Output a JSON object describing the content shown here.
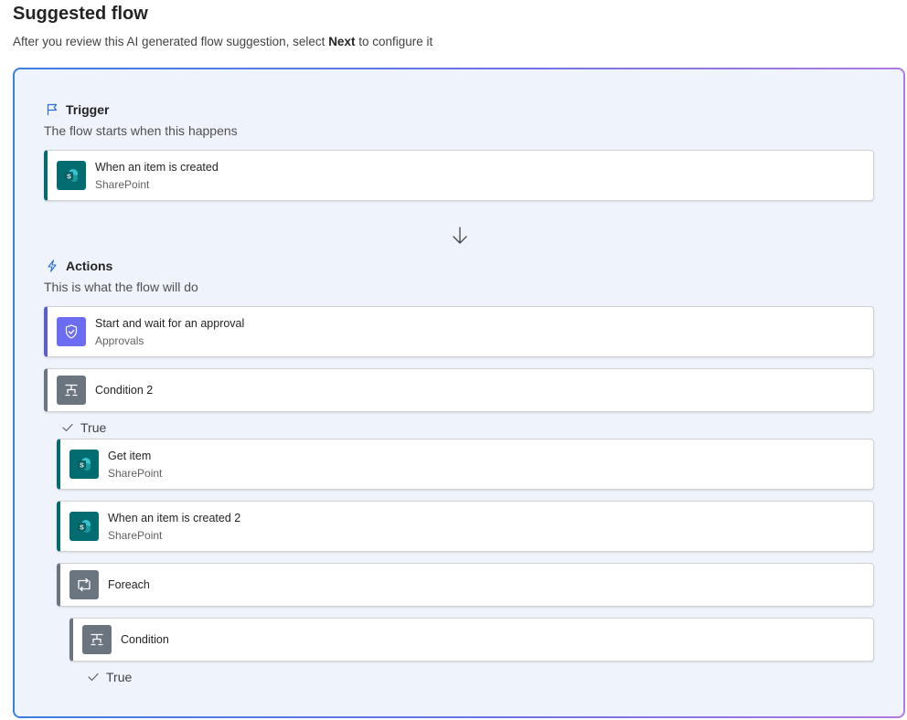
{
  "header": {
    "title": "Suggested flow",
    "subtitle_prefix": "After you review this AI generated flow suggestion, select ",
    "subtitle_bold": "Next",
    "subtitle_suffix": " to configure it"
  },
  "trigger": {
    "heading": "Trigger",
    "description": "The flow starts when this happens",
    "icon": "flag-icon",
    "card": {
      "title": "When an item is created",
      "connector": "SharePoint",
      "icon": "sharepoint-icon"
    }
  },
  "actions": {
    "heading": "Actions",
    "description": "This is what the flow will do",
    "icon": "lightning-icon",
    "steps": [
      {
        "title": "Start and wait for an approval",
        "connector": "Approvals",
        "icon": "approvals-icon"
      },
      {
        "title": "Condition 2",
        "icon": "condition-icon"
      },
      {
        "branch_label": "True"
      },
      {
        "title": "Get item",
        "connector": "SharePoint",
        "icon": "sharepoint-icon"
      },
      {
        "title": "When an item is created 2",
        "connector": "SharePoint",
        "icon": "sharepoint-icon"
      },
      {
        "title": "Foreach",
        "icon": "loop-icon"
      },
      {
        "title": "Condition",
        "icon": "condition-icon"
      },
      {
        "branch_label": "True"
      }
    ]
  },
  "colors": {
    "sharepoint": "#036c70",
    "approvals": "#5b5fc7",
    "control": "#6b7580",
    "frame_background": "#eff4fc"
  }
}
